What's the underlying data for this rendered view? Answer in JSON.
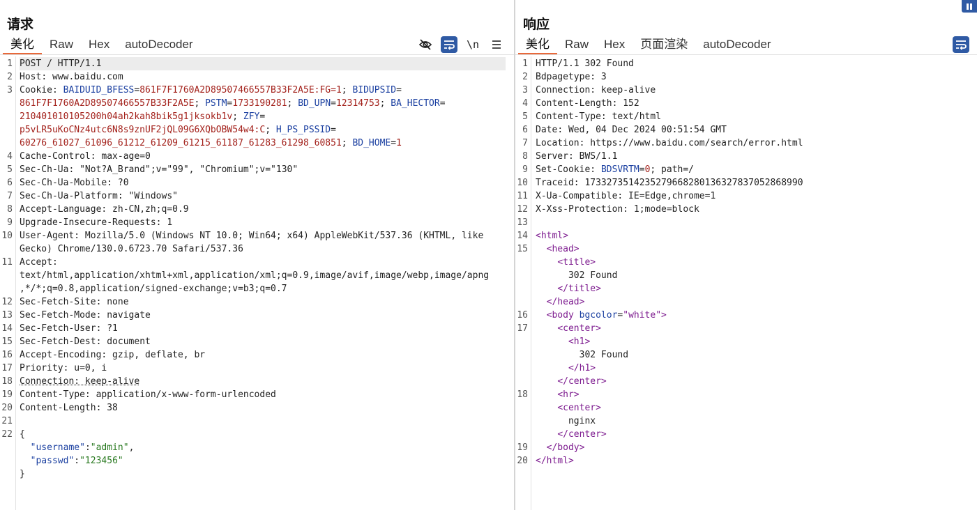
{
  "request": {
    "title": "请求",
    "tabs": [
      "美化",
      "Raw",
      "Hex",
      "autoDecoder"
    ],
    "toolbar": {
      "newline_label": "\\n"
    },
    "lines": [
      {
        "n": "1",
        "segs": [
          [
            "POST / HTTP/1.1",
            ""
          ]
        ],
        "cur": true
      },
      {
        "n": "2",
        "segs": [
          [
            "Host",
            ""
          ],
          [
            ": www.baidu.com",
            ""
          ]
        ]
      },
      {
        "n": "3",
        "segs": [
          [
            "Cookie",
            ""
          ],
          [
            ": ",
            ""
          ],
          [
            "BAIDUID_BFESS",
            "k"
          ],
          [
            "=",
            ""
          ],
          [
            "861F7F1760A2D89507466557B33F2A5E:FG=1",
            "v"
          ],
          [
            "; ",
            ""
          ],
          [
            "BIDUPSID",
            "k"
          ],
          [
            "=",
            ""
          ]
        ]
      },
      {
        "n": "",
        "segs": [
          [
            "861F7F1760A2D89507466557B33F2A5E",
            "v"
          ],
          [
            "; ",
            ""
          ],
          [
            "PSTM",
            "k"
          ],
          [
            "=",
            ""
          ],
          [
            "1733190281",
            "v"
          ],
          [
            "; ",
            ""
          ],
          [
            "BD_UPN",
            "k"
          ],
          [
            "=",
            ""
          ],
          [
            "12314753",
            "v"
          ],
          [
            "; ",
            ""
          ],
          [
            "BA_HECTOR",
            "k"
          ],
          [
            "=",
            ""
          ]
        ]
      },
      {
        "n": "",
        "segs": [
          [
            "210401010105200h04ah2kah8bik5g1jksokb1v",
            "v"
          ],
          [
            "; ",
            ""
          ],
          [
            "ZFY",
            "k"
          ],
          [
            "=",
            ""
          ]
        ]
      },
      {
        "n": "",
        "segs": [
          [
            "p5vLR5uKoCNz4utc6N8s9znUF2jQL09G6XQbOBW54w4:C",
            "v"
          ],
          [
            "; ",
            ""
          ],
          [
            "H_PS_PSSID",
            "k"
          ],
          [
            "=",
            ""
          ]
        ]
      },
      {
        "n": "",
        "segs": [
          [
            "60276_61027_61096_61212_61209_61215_61187_61283_61298_60851",
            "v"
          ],
          [
            "; ",
            ""
          ],
          [
            "BD_HOME",
            "k"
          ],
          [
            "=",
            ""
          ],
          [
            "1",
            "v"
          ]
        ]
      },
      {
        "n": "4",
        "segs": [
          [
            "Cache-Control",
            ""
          ],
          [
            ": max-age=0",
            ""
          ]
        ]
      },
      {
        "n": "5",
        "segs": [
          [
            "Sec-Ch-Ua",
            ""
          ],
          [
            ": \"Not?A_Brand\";v=\"99\", \"Chromium\";v=\"130\"",
            ""
          ]
        ]
      },
      {
        "n": "6",
        "segs": [
          [
            "Sec-Ch-Ua-Mobile",
            ""
          ],
          [
            ": ?0",
            ""
          ]
        ]
      },
      {
        "n": "7",
        "segs": [
          [
            "Sec-Ch-Ua-Platform",
            ""
          ],
          [
            ": \"Windows\"",
            ""
          ]
        ]
      },
      {
        "n": "8",
        "segs": [
          [
            "Accept-Language",
            ""
          ],
          [
            ": zh-CN,zh;q=0.9",
            ""
          ]
        ]
      },
      {
        "n": "9",
        "segs": [
          [
            "Upgrade-Insecure-Requests",
            ""
          ],
          [
            ": 1",
            ""
          ]
        ]
      },
      {
        "n": "10",
        "segs": [
          [
            "User-Agent",
            ""
          ],
          [
            ": Mozilla/5.0 (Windows NT 10.0; Win64; x64) AppleWebKit/537.36 (KHTML, like",
            ""
          ]
        ]
      },
      {
        "n": "",
        "segs": [
          [
            "Gecko) Chrome/130.0.6723.70 Safari/537.36",
            ""
          ]
        ]
      },
      {
        "n": "11",
        "segs": [
          [
            "Accept",
            ""
          ],
          [
            ":",
            ""
          ]
        ]
      },
      {
        "n": "",
        "segs": [
          [
            "text/html,application/xhtml+xml,application/xml;q=0.9,image/avif,image/webp,image/apng",
            ""
          ]
        ]
      },
      {
        "n": "",
        "segs": [
          [
            ",*/*;q=0.8,application/signed-exchange;v=b3;q=0.7",
            ""
          ]
        ]
      },
      {
        "n": "12",
        "segs": [
          [
            "Sec-Fetch-Site",
            ""
          ],
          [
            ": none",
            ""
          ]
        ]
      },
      {
        "n": "13",
        "segs": [
          [
            "Sec-Fetch-Mode",
            ""
          ],
          [
            ": navigate",
            ""
          ]
        ]
      },
      {
        "n": "14",
        "segs": [
          [
            "Sec-Fetch-User",
            ""
          ],
          [
            ": ?1",
            ""
          ]
        ]
      },
      {
        "n": "15",
        "segs": [
          [
            "Sec-Fetch-Dest",
            ""
          ],
          [
            ": document",
            ""
          ]
        ]
      },
      {
        "n": "16",
        "segs": [
          [
            "Accept-Encoding",
            ""
          ],
          [
            ": gzip, deflate, br",
            ""
          ]
        ]
      },
      {
        "n": "17",
        "segs": [
          [
            "Priority",
            ""
          ],
          [
            ": u=0, i",
            ""
          ]
        ]
      },
      {
        "n": "18",
        "segs": [
          [
            "Connection: keep-alive",
            "uline"
          ]
        ]
      },
      {
        "n": "19",
        "segs": [
          [
            "Content-Type",
            ""
          ],
          [
            ": application/x-www-form-urlencoded",
            ""
          ]
        ]
      },
      {
        "n": "20",
        "segs": [
          [
            "Content-Length",
            ""
          ],
          [
            ": 38",
            ""
          ]
        ]
      },
      {
        "n": "21",
        "segs": []
      },
      {
        "n": "22",
        "segs": [
          [
            "{",
            ""
          ]
        ]
      },
      {
        "n": "",
        "segs": [
          [
            "  ",
            ""
          ],
          [
            "\"username\"",
            "k"
          ],
          [
            ":",
            ""
          ],
          [
            "\"admin\"",
            "s"
          ],
          [
            ",",
            ""
          ]
        ]
      },
      {
        "n": "",
        "segs": [
          [
            "  ",
            ""
          ],
          [
            "\"passwd\"",
            "k"
          ],
          [
            ":",
            ""
          ],
          [
            "\"123456\"",
            "s"
          ]
        ]
      },
      {
        "n": "",
        "segs": [
          [
            "}",
            ""
          ]
        ]
      }
    ]
  },
  "response": {
    "title": "响应",
    "tabs": [
      "美化",
      "Raw",
      "Hex",
      "页面渲染",
      "autoDecoder"
    ],
    "lines": [
      {
        "n": "1",
        "segs": [
          [
            "HTTP/1.1 302 Found",
            ""
          ]
        ]
      },
      {
        "n": "2",
        "segs": [
          [
            "Bdpagetype",
            ""
          ],
          [
            ": 3",
            ""
          ]
        ]
      },
      {
        "n": "3",
        "segs": [
          [
            "Connection",
            ""
          ],
          [
            ": keep-alive",
            ""
          ]
        ]
      },
      {
        "n": "4",
        "segs": [
          [
            "Content-Length",
            ""
          ],
          [
            ": 152",
            ""
          ]
        ]
      },
      {
        "n": "5",
        "segs": [
          [
            "Content-Type",
            ""
          ],
          [
            ": text/html",
            ""
          ]
        ]
      },
      {
        "n": "6",
        "segs": [
          [
            "Date",
            ""
          ],
          [
            ": Wed, 04 Dec 2024 00:51:54 GMT",
            ""
          ]
        ]
      },
      {
        "n": "7",
        "segs": [
          [
            "Location",
            ""
          ],
          [
            ": https://www.baidu.com/search/error.html",
            ""
          ]
        ]
      },
      {
        "n": "8",
        "segs": [
          [
            "Server",
            ""
          ],
          [
            ": BWS/1.1",
            ""
          ]
        ]
      },
      {
        "n": "9",
        "segs": [
          [
            "Set-Cookie",
            ""
          ],
          [
            ": ",
            ""
          ],
          [
            "BDSVRTM",
            "k"
          ],
          [
            "=",
            ""
          ],
          [
            "0",
            "v"
          ],
          [
            "; path=/",
            ""
          ]
        ]
      },
      {
        "n": "10",
        "segs": [
          [
            "Traceid",
            ""
          ],
          [
            ": 1733273514235279668280136327837052868990",
            ""
          ]
        ]
      },
      {
        "n": "11",
        "segs": [
          [
            "X-Ua-Compatible",
            ""
          ],
          [
            ": IE=Edge,chrome=1",
            ""
          ]
        ]
      },
      {
        "n": "12",
        "segs": [
          [
            "X-Xss-Protection",
            ""
          ],
          [
            ": 1;mode=block",
            ""
          ]
        ]
      },
      {
        "n": "13",
        "segs": []
      },
      {
        "n": "14",
        "segs": [
          [
            "<html>",
            "tag"
          ]
        ]
      },
      {
        "n": "15",
        "segs": [
          [
            "  ",
            ""
          ],
          [
            "<head>",
            "tag"
          ]
        ]
      },
      {
        "n": "",
        "segs": [
          [
            "    ",
            ""
          ],
          [
            "<title>",
            "tag"
          ]
        ]
      },
      {
        "n": "",
        "segs": [
          [
            "      302 Found",
            ""
          ]
        ]
      },
      {
        "n": "",
        "segs": [
          [
            "    ",
            ""
          ],
          [
            "</title>",
            "tag"
          ]
        ]
      },
      {
        "n": "",
        "segs": [
          [
            "  ",
            ""
          ],
          [
            "</head>",
            "tag"
          ]
        ]
      },
      {
        "n": "16",
        "segs": [
          [
            "  ",
            ""
          ],
          [
            "<body ",
            "tag"
          ],
          [
            "bgcolor",
            "an"
          ],
          [
            "=",
            ""
          ],
          [
            "\"white\"",
            "tag"
          ],
          [
            ">",
            "tag"
          ]
        ]
      },
      {
        "n": "17",
        "segs": [
          [
            "    ",
            ""
          ],
          [
            "<center>",
            "tag"
          ]
        ]
      },
      {
        "n": "",
        "segs": [
          [
            "      ",
            ""
          ],
          [
            "<h1>",
            "tag"
          ]
        ]
      },
      {
        "n": "",
        "segs": [
          [
            "        302 Found",
            ""
          ]
        ]
      },
      {
        "n": "",
        "segs": [
          [
            "      ",
            ""
          ],
          [
            "</h1>",
            "tag"
          ]
        ]
      },
      {
        "n": "",
        "segs": [
          [
            "    ",
            ""
          ],
          [
            "</center>",
            "tag"
          ]
        ]
      },
      {
        "n": "18",
        "segs": [
          [
            "    ",
            ""
          ],
          [
            "<hr>",
            "tag"
          ]
        ]
      },
      {
        "n": "",
        "segs": [
          [
            "    ",
            ""
          ],
          [
            "<center>",
            "tag"
          ]
        ]
      },
      {
        "n": "",
        "segs": [
          [
            "      nginx",
            ""
          ]
        ]
      },
      {
        "n": "",
        "segs": [
          [
            "    ",
            ""
          ],
          [
            "</center>",
            "tag"
          ]
        ]
      },
      {
        "n": "19",
        "segs": [
          [
            "  ",
            ""
          ],
          [
            "</body>",
            "tag"
          ]
        ]
      },
      {
        "n": "20",
        "segs": [
          [
            "</html>",
            "tag"
          ]
        ]
      }
    ]
  }
}
